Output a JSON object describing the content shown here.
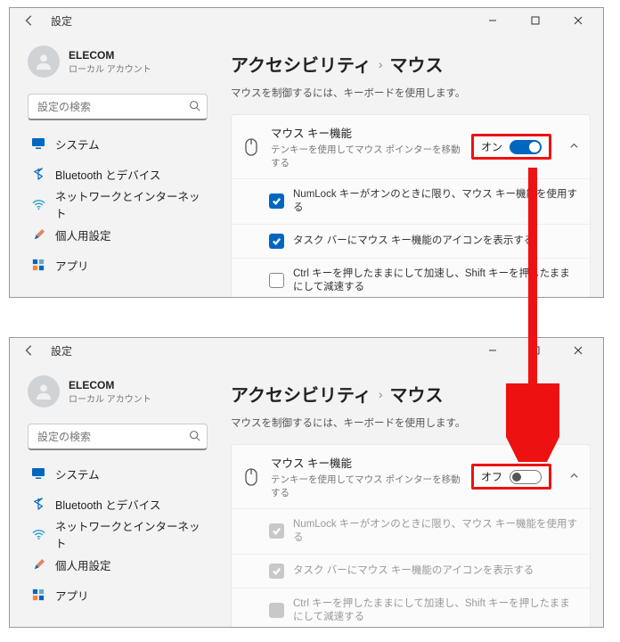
{
  "arrow_color": "#e11",
  "common": {
    "titlebar": {
      "label": "設定"
    },
    "account": {
      "name": "ELECOM",
      "sub": "ローカル アカウント"
    },
    "search": {
      "placeholder": "設定の検索"
    },
    "nav": {
      "system": "システム",
      "bluetooth": "Bluetooth とデバイス",
      "network": "ネットワークとインターネット",
      "personalization": "個人用設定",
      "apps": "アプリ"
    },
    "breadcrumb": {
      "parent": "アクセシビリティ",
      "sep": "›",
      "current": "マウス"
    },
    "desc": "マウスを制御するには、キーボードを使用します。",
    "card": {
      "title": "マウス キー機能",
      "sub": "テンキーを使用してマウス ポインターを移動する"
    },
    "subs": {
      "numlock": "NumLock キーがオンのときに限り、マウス キー機能を使用する",
      "taskbar": "タスク バーにマウス キー機能のアイコンを表示する",
      "ctrlshift": "Ctrl キーを押したままにして加速し、Shift キーを押したままにして減速する"
    }
  },
  "win1": {
    "toggle_label": "オン"
  },
  "win2": {
    "toggle_label": "オフ"
  }
}
